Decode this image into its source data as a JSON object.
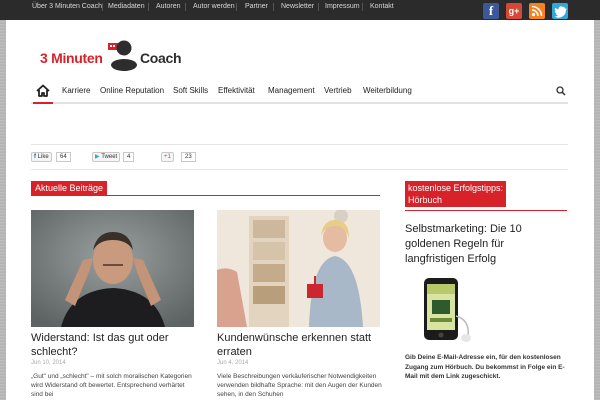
{
  "topbar": {
    "links": [
      "Über 3 Minuten Coach",
      "Mediadaten",
      "Autoren",
      "Autor werden",
      "Partner",
      "Newsletter",
      "Impressum",
      "Kontakt"
    ],
    "social": [
      {
        "name": "facebook-icon",
        "glyph": "f",
        "color": "#3b5998"
      },
      {
        "name": "google-plus-icon",
        "glyph": "g+",
        "color": "#d34836"
      },
      {
        "name": "rss-icon",
        "glyph": "",
        "color": "#f58220"
      },
      {
        "name": "twitter-icon",
        "glyph": "",
        "color": "#33a6db"
      }
    ]
  },
  "logo": {
    "part1": "3 Minuten",
    "part2": "Coach"
  },
  "nav": {
    "items": [
      "Karriere",
      "Online Reputation",
      "Soft Skills",
      "Effektivität",
      "Management",
      "Vertrieb",
      "Weiterbildung"
    ]
  },
  "share": {
    "facebook": {
      "label": "Like",
      "count": "64"
    },
    "twitter": {
      "label": "Tweet",
      "count": "4"
    },
    "google": {
      "label": "+1",
      "count": "23"
    }
  },
  "sections": {
    "main": "Aktuelle Beiträge",
    "sidebar_line1": "kostenlose Erfolgstipps:",
    "sidebar_line2": "Hörbuch"
  },
  "articles": [
    {
      "title": "Widerstand: Ist das gut oder schlecht?",
      "date": "Jun 10, 2014",
      "excerpt": "„Gut\" und „schlecht\" – mit solch moralischen Kategorien wird Widerstand oft bewertet. Entsprechend verhärtet sind bei"
    },
    {
      "title": "Kundenwünsche erkennen statt erraten",
      "date": "Jun 4, 2014",
      "excerpt": "Viele Beschreibungen verkäuferischer Notwendigkeiten verwenden bildhafte Sprache: mit den Augen der Kunden sehen, in den Schuhen"
    }
  ],
  "sidebar": {
    "title": "Selbstmarketing: Die 10 goldenen Regeln für langfristigen Erfolg",
    "text": "Gib Deine E-Mail-Adresse ein, für den kostenlosen Zugang zum Hörbuch. Du bekommst in Folge ein E-Mail mit dem Link zugeschickt."
  },
  "colors": {
    "accent": "#d8222a",
    "topbar": "#2b2b2b"
  }
}
